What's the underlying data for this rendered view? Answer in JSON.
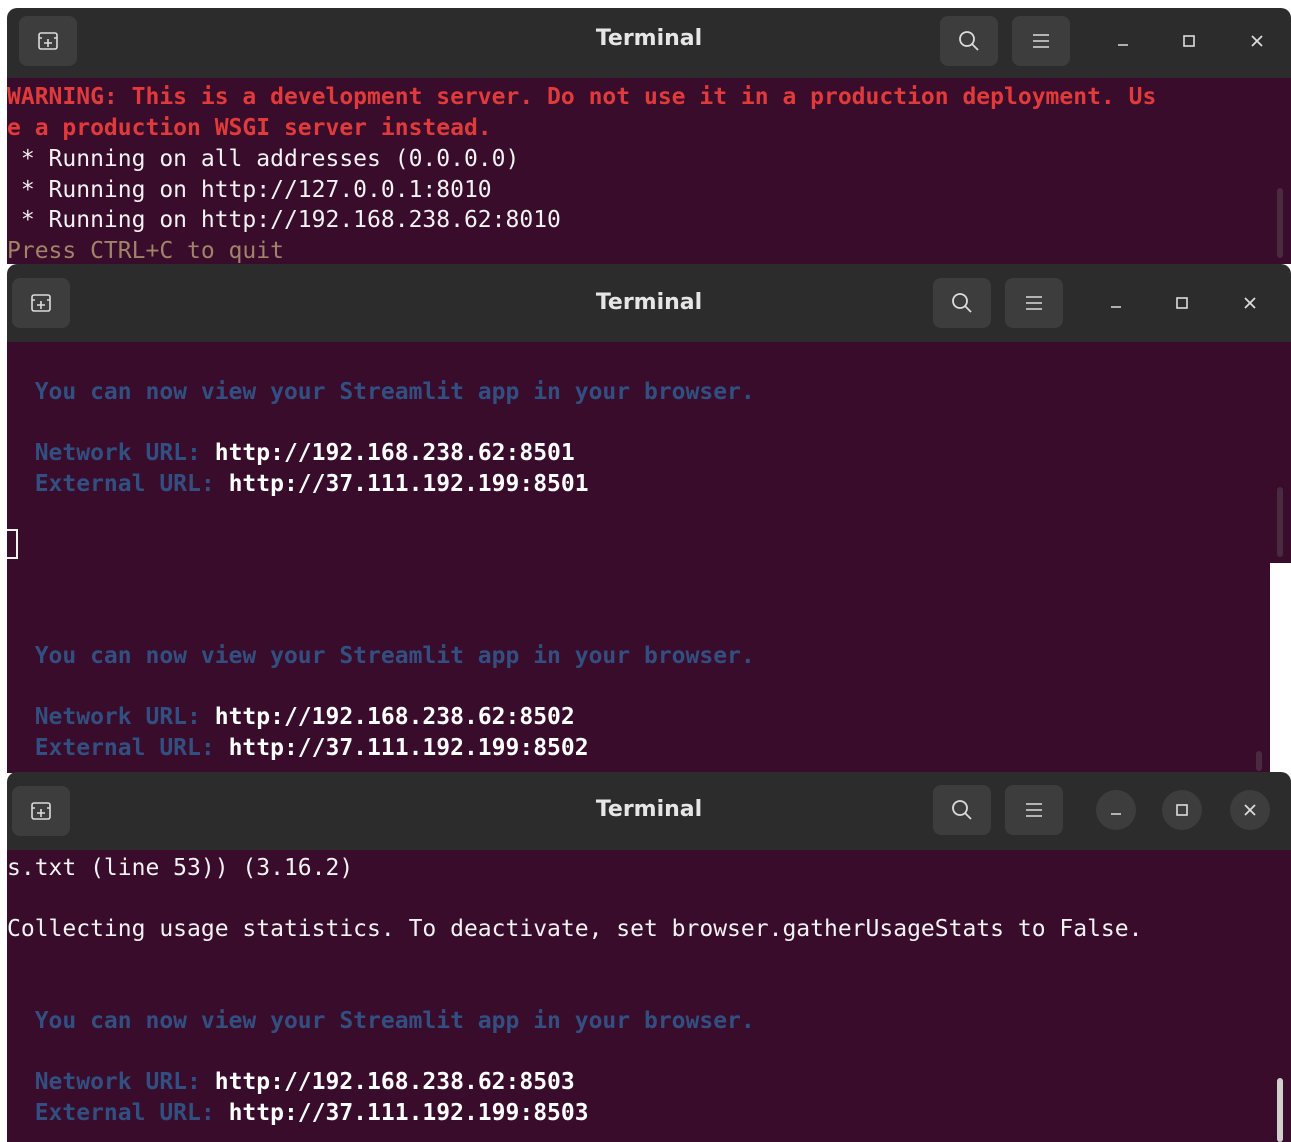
{
  "windows": [
    {
      "title": "Terminal",
      "lines": {
        "warning_1": "WARNING: This is a development server. Do not use it in a production deployment. Us",
        "warning_2": "e a production WSGI server instead.",
        "running_1": " * Running on all addresses (0.0.0.0)",
        "running_2": " * Running on http://127.0.0.1:8010",
        "running_3": " * Running on http://192.168.238.62:8010",
        "quit": "Press CTRL+C to quit"
      }
    },
    {
      "title": "Terminal",
      "lines": {
        "view": "  You can now view your Streamlit app in your browser.",
        "network_label": "  Network URL: ",
        "network_url": "http://192.168.238.62:8501",
        "external_label": "  External URL: ",
        "external_url": "http://37.111.192.199:8501"
      }
    },
    {
      "lines": {
        "view": "  You can now view your Streamlit app in your browser.",
        "network_label": "  Network URL: ",
        "network_url": "http://192.168.238.62:8502",
        "external_label": "  External URL: ",
        "external_url": "http://37.111.192.199:8502"
      }
    },
    {
      "title": "Terminal",
      "lines": {
        "req": "s.txt (line 53)) (3.16.2)",
        "collecting": "Collecting usage statistics. To deactivate, set browser.gatherUsageStats to False.",
        "view": "  You can now view your Streamlit app in your browser.",
        "network_label": "  Network URL: ",
        "network_url": "http://192.168.238.62:8503",
        "external_label": "  External URL: ",
        "external_url": "http://37.111.192.199:8503"
      }
    }
  ],
  "icons": {
    "new_tab": "new-tab-icon",
    "search": "search-icon",
    "menu": "hamburger-menu-icon",
    "minimize": "minimize-icon",
    "maximize": "maximize-icon",
    "close": "close-icon"
  },
  "colors": {
    "terminal_bg": "#380c2a",
    "titlebar_bg": "#2c2c2c",
    "warning": "#e03a3a",
    "streamlit_text": "#324f82"
  }
}
